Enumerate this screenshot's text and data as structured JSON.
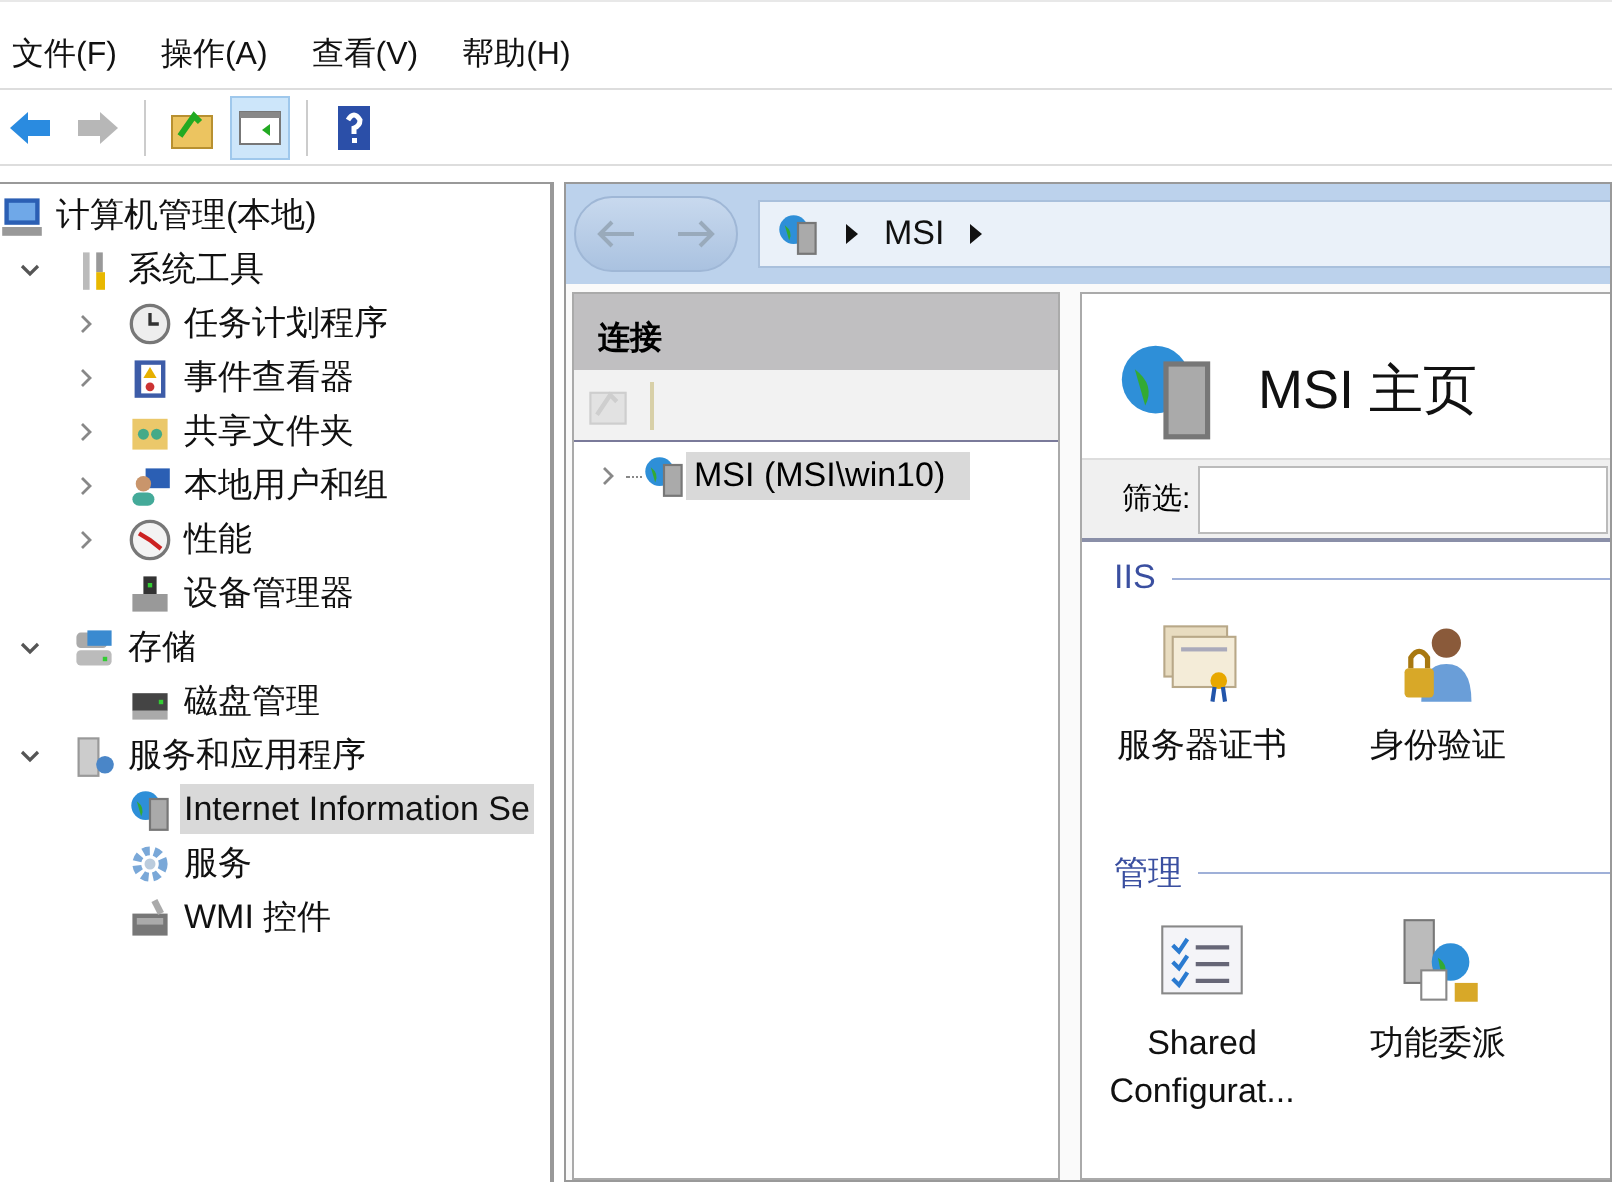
{
  "menu": [
    "文件(F)",
    "操作(A)",
    "查看(V)",
    "帮助(H)"
  ],
  "toolbar": [
    {
      "kind": "back",
      "disabled": false,
      "selected": false
    },
    {
      "kind": "forward",
      "disabled": true,
      "selected": false
    },
    {
      "kind": "up",
      "disabled": false,
      "selected": false
    },
    {
      "kind": "pane",
      "disabled": false,
      "selected": true
    },
    {
      "kind": "help",
      "disabled": false,
      "selected": false
    }
  ],
  "tree": {
    "label": "计算机管理(本地)",
    "selected": false,
    "children": [
      {
        "label": "系统工具",
        "selected": false,
        "expanded": true,
        "children": [
          {
            "label": "任务计划程序",
            "selected": false,
            "expanded": false
          },
          {
            "label": "事件查看器",
            "selected": false,
            "expanded": false
          },
          {
            "label": "共享文件夹",
            "selected": false,
            "expanded": false
          },
          {
            "label": "本地用户和组",
            "selected": false,
            "expanded": false
          },
          {
            "label": "性能",
            "selected": false,
            "expanded": false
          },
          {
            "label": "设备管理器",
            "selected": false
          }
        ]
      },
      {
        "label": "存储",
        "selected": false,
        "expanded": true,
        "children": [
          {
            "label": "磁盘管理",
            "selected": false
          }
        ]
      },
      {
        "label": "服务和应用程序",
        "selected": false,
        "expanded": true,
        "children": [
          {
            "label": "Internet Information Se",
            "selected": true
          },
          {
            "label": "服务",
            "selected": false
          },
          {
            "label": "WMI 控件",
            "selected": false
          }
        ]
      }
    ]
  },
  "address": {
    "crumbs": [
      "MSI"
    ]
  },
  "connections": {
    "title": "连接",
    "items": [
      {
        "label": "MSI (MSI\\win10)",
        "selected": true,
        "expanded": false
      }
    ]
  },
  "home": {
    "title": "MSI 主页",
    "filter": {
      "label": "筛选:"
    },
    "sections": [
      {
        "title": "IIS",
        "features": [
          {
            "kind": "certificate",
            "label": "服务器证书"
          },
          {
            "kind": "auth",
            "label": "身份验证"
          }
        ]
      },
      {
        "title": "管理",
        "features": [
          {
            "kind": "config",
            "label": "Shared Configurat..."
          },
          {
            "kind": "delegation",
            "label": "功能委派"
          }
        ]
      }
    ]
  }
}
